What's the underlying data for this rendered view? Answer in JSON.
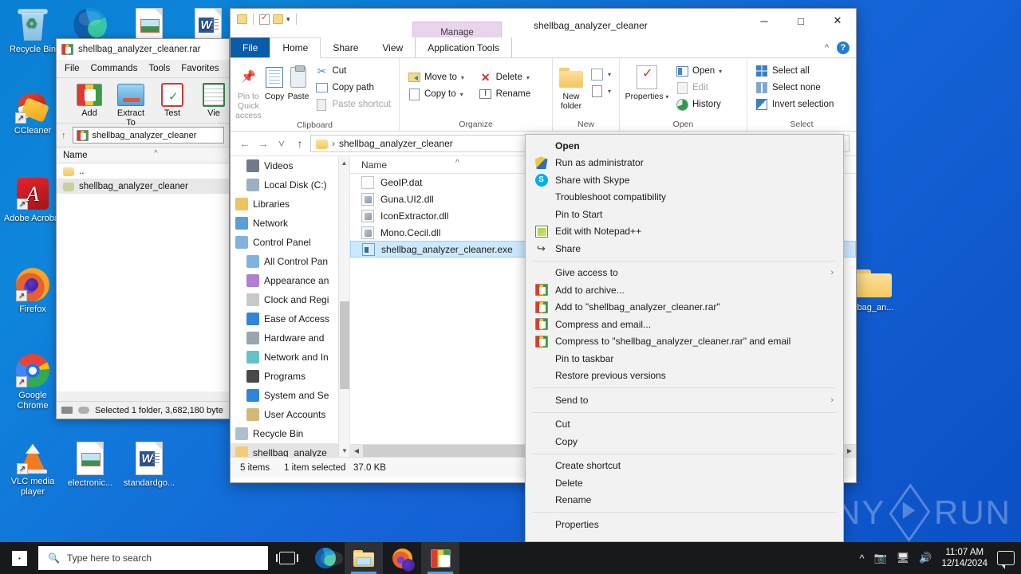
{
  "desktop": {
    "icons": [
      {
        "label": "Recycle Bin",
        "icon": "recycle-bin-icon"
      },
      {
        "label": "CCleaner",
        "icon": "ccleaner-icon"
      },
      {
        "label": "Adobe Acrobat",
        "icon": "adobe-acrobat-icon"
      },
      {
        "label": "Firefox",
        "icon": "firefox-icon"
      },
      {
        "label": "Google Chrome",
        "icon": "google-chrome-icon"
      },
      {
        "label": "VLC media player",
        "icon": "vlc-icon"
      },
      {
        "label": "electronic...",
        "icon": "image-document-icon"
      },
      {
        "label": "standardgo...",
        "icon": "word-document-icon"
      },
      {
        "label": "llbag_an...",
        "icon": "folder-icon"
      }
    ],
    "watermark": {
      "left": "ANY",
      "right": "RUN"
    }
  },
  "winrar": {
    "title": "shellbag_analyzer_cleaner.rar",
    "menu": [
      "File",
      "Commands",
      "Tools",
      "Favorites"
    ],
    "toolbar": [
      {
        "label": "Add",
        "icon": "rar-add-icon"
      },
      {
        "label": "Extract To",
        "icon": "extract-to-icon"
      },
      {
        "label": "Test",
        "icon": "test-icon"
      },
      {
        "label": "Vie",
        "icon": "view-icon"
      }
    ],
    "address": "shellbag_analyzer_cleaner",
    "column_header": "Name",
    "rows": [
      {
        "name": "..",
        "selected": false
      },
      {
        "name": "shellbag_analyzer_cleaner",
        "selected": true
      }
    ],
    "status": "Selected 1 folder, 3,682,180 byte"
  },
  "explorer": {
    "title": "shellbag_analyzer_cleaner",
    "contextual_tab": "Manage",
    "tabs": [
      {
        "label": "File"
      },
      {
        "label": "Home"
      },
      {
        "label": "Share"
      },
      {
        "label": "View"
      },
      {
        "label": "Application Tools"
      }
    ],
    "window_buttons": {
      "minimize": "─",
      "maximize": "□",
      "close": "✕"
    },
    "ribbon_collapse": "^",
    "help": "?",
    "ribbon": {
      "clipboard": {
        "name": "Clipboard",
        "big": [
          {
            "label": "Pin to Quick access",
            "icon": "pin-icon",
            "dim": true
          },
          {
            "label": "Copy",
            "icon": "copy-icon",
            "dim": false
          },
          {
            "label": "Paste",
            "icon": "paste-icon",
            "dim": false
          }
        ],
        "small": [
          {
            "label": "Cut",
            "icon": "scissors-icon",
            "dim": false
          },
          {
            "label": "Copy path",
            "icon": "copy-path-icon",
            "dim": false
          },
          {
            "label": "Paste shortcut",
            "icon": "paste-shortcut-icon",
            "dim": true
          }
        ]
      },
      "organize": {
        "name": "Organize",
        "small": [
          {
            "label": "Move to",
            "icon": "move-to-icon",
            "caret": true
          },
          {
            "label": "Copy to",
            "icon": "copy-to-icon",
            "caret": true
          },
          {
            "label": "Delete",
            "icon": "delete-icon",
            "caret": true
          },
          {
            "label": "Rename",
            "icon": "rename-icon",
            "caret": false
          }
        ]
      },
      "new": {
        "name": "New",
        "big": [
          {
            "label": "New folder",
            "icon": "new-folder-icon"
          }
        ],
        "small": [
          {
            "label": "",
            "icon": "new-item-icon",
            "caret": true
          },
          {
            "label": "",
            "icon": "easy-access-icon",
            "caret": true
          }
        ]
      },
      "open": {
        "name": "Open",
        "big": [
          {
            "label": "Properties",
            "icon": "properties-icon",
            "caret": true
          }
        ],
        "small": [
          {
            "label": "Open",
            "icon": "open-icon",
            "caret": true,
            "dim": false
          },
          {
            "label": "Edit",
            "icon": "edit-icon",
            "caret": false,
            "dim": true
          },
          {
            "label": "History",
            "icon": "history-icon",
            "caret": false,
            "dim": false
          }
        ]
      },
      "select": {
        "name": "Select",
        "small": [
          {
            "label": "Select all",
            "icon": "select-all-icon"
          },
          {
            "label": "Select none",
            "icon": "select-none-icon"
          },
          {
            "label": "Invert selection",
            "icon": "invert-selection-icon"
          }
        ]
      }
    },
    "address_bar": {
      "back": "←",
      "forward": "→",
      "recent": "˅",
      "up": "↑",
      "crumb_folder_icon": "folder-icon",
      "crumb_separator": "›",
      "path": "shellbag_analyzer_cleaner",
      "search_placeholder": ""
    },
    "nav_tree": [
      {
        "label": "Videos",
        "icon": "videos-icon",
        "indent": 1,
        "selected": false
      },
      {
        "label": "Local Disk (C:)",
        "icon": "disk-icon",
        "indent": 1,
        "selected": false
      },
      {
        "label": "Libraries",
        "icon": "libraries-icon",
        "indent": 0,
        "selected": false
      },
      {
        "label": "Network",
        "icon": "network-icon",
        "indent": 0,
        "selected": false
      },
      {
        "label": "Control Panel",
        "icon": "control-panel-icon",
        "indent": 0,
        "selected": false
      },
      {
        "label": "All Control Pan",
        "icon": "all-control-panel-icon",
        "indent": 1,
        "selected": false
      },
      {
        "label": "Appearance an",
        "icon": "appearance-icon",
        "indent": 1,
        "selected": false
      },
      {
        "label": "Clock and Regi",
        "icon": "clock-icon",
        "indent": 1,
        "selected": false
      },
      {
        "label": "Ease of Access",
        "icon": "ease-of-access-icon",
        "indent": 1,
        "selected": false
      },
      {
        "label": "Hardware and",
        "icon": "hardware-icon",
        "indent": 1,
        "selected": false
      },
      {
        "label": "Network and In",
        "icon": "network-internet-icon",
        "indent": 1,
        "selected": false
      },
      {
        "label": "Programs",
        "icon": "programs-icon",
        "indent": 1,
        "selected": false
      },
      {
        "label": "System and Se",
        "icon": "system-security-icon",
        "indent": 1,
        "selected": false
      },
      {
        "label": "User Accounts",
        "icon": "user-accounts-icon",
        "indent": 1,
        "selected": false
      },
      {
        "label": "Recycle Bin",
        "icon": "recycle-bin-icon",
        "indent": 0,
        "selected": false
      },
      {
        "label": "shellbag_analyze",
        "icon": "folder-icon",
        "indent": 0,
        "selected": true
      }
    ],
    "files": {
      "column_header": "Name",
      "rows": [
        {
          "name": "GeoIP.dat",
          "icon": "dat-file-icon",
          "selected": false
        },
        {
          "name": "Guna.UI2.dll",
          "icon": "dll-file-icon",
          "selected": false
        },
        {
          "name": "IconExtractor.dll",
          "icon": "dll-file-icon",
          "selected": false
        },
        {
          "name": "Mono.Cecil.dll",
          "icon": "dll-file-icon",
          "selected": false
        },
        {
          "name": "shellbag_analyzer_cleaner.exe",
          "icon": "exe-file-icon",
          "selected": true
        }
      ]
    },
    "status": {
      "items": "5 items",
      "selection": "1 item selected",
      "size": "37.0 KB"
    }
  },
  "context_menu": {
    "items": [
      {
        "label": "Open",
        "icon": null,
        "bold": true,
        "submenu": false
      },
      {
        "label": "Run as administrator",
        "icon": "shield-icon",
        "bold": false,
        "submenu": false
      },
      {
        "label": "Share with Skype",
        "icon": "skype-icon",
        "bold": false,
        "submenu": false
      },
      {
        "label": "Troubleshoot compatibility",
        "icon": null,
        "bold": false,
        "submenu": false
      },
      {
        "label": "Pin to Start",
        "icon": null,
        "bold": false,
        "submenu": false
      },
      {
        "label": "Edit with Notepad++",
        "icon": "notepadpp-icon",
        "bold": false,
        "submenu": false
      },
      {
        "label": "Share",
        "icon": "share-icon",
        "bold": false,
        "submenu": false
      },
      {
        "separator": true
      },
      {
        "label": "Give access to",
        "icon": null,
        "bold": false,
        "submenu": true
      },
      {
        "label": "Add to archive...",
        "icon": "winrar-icon",
        "bold": false,
        "submenu": false
      },
      {
        "label": "Add to \"shellbag_analyzer_cleaner.rar\"",
        "icon": "winrar-icon",
        "bold": false,
        "submenu": false
      },
      {
        "label": "Compress and email...",
        "icon": "winrar-icon",
        "bold": false,
        "submenu": false
      },
      {
        "label": "Compress to \"shellbag_analyzer_cleaner.rar\" and email",
        "icon": "winrar-icon",
        "bold": false,
        "submenu": false
      },
      {
        "label": "Pin to taskbar",
        "icon": null,
        "bold": false,
        "submenu": false
      },
      {
        "label": "Restore previous versions",
        "icon": null,
        "bold": false,
        "submenu": false
      },
      {
        "separator": true
      },
      {
        "label": "Send to",
        "icon": null,
        "bold": false,
        "submenu": true
      },
      {
        "separator": true
      },
      {
        "label": "Cut",
        "icon": null,
        "bold": false,
        "submenu": false
      },
      {
        "label": "Copy",
        "icon": null,
        "bold": false,
        "submenu": false
      },
      {
        "separator": true
      },
      {
        "label": "Create shortcut",
        "icon": null,
        "bold": false,
        "submenu": false
      },
      {
        "label": "Delete",
        "icon": null,
        "bold": false,
        "submenu": false
      },
      {
        "label": "Rename",
        "icon": null,
        "bold": false,
        "submenu": false
      },
      {
        "separator": true
      },
      {
        "label": "Properties",
        "icon": null,
        "bold": false,
        "submenu": false
      }
    ],
    "submenu_arrow": "›"
  },
  "taskbar": {
    "start_icon": "windows-start-icon",
    "search_placeholder": "Type here to search",
    "search_icon": "search-icon",
    "buttons": [
      {
        "name": "task-view-icon",
        "active": false
      },
      {
        "name": "edge-icon",
        "active": false
      },
      {
        "name": "file-explorer-icon",
        "active": true
      },
      {
        "name": "firefox-icon",
        "active": false
      },
      {
        "name": "winrar-icon",
        "active": true
      }
    ],
    "tray": {
      "chevron": "^",
      "icons": [
        "camera-icon",
        "network-icon",
        "volume-icon"
      ],
      "time": "11:07 AM",
      "date": "12/14/2024",
      "action_center": "notifications-icon"
    }
  },
  "colors": {
    "desktop_blue": "#0e6fd0",
    "explorer_file_tab": "#0a5ca8",
    "manage_tab_pink": "#e9d4ee",
    "selection_blue": "#cce8ff",
    "taskbar_dark": "#17191c",
    "accent": "#40a8f0"
  }
}
